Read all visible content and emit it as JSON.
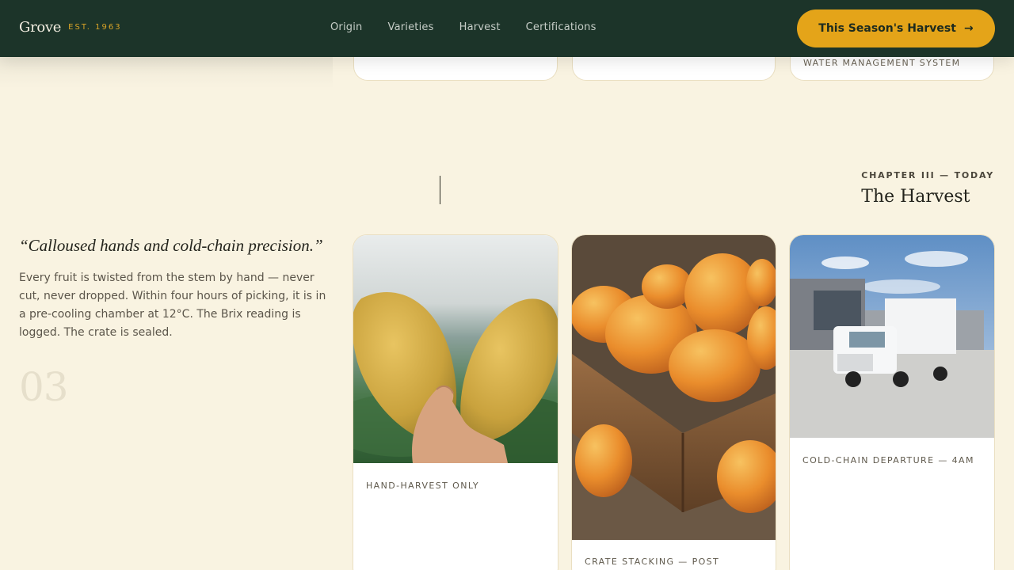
{
  "nav": {
    "brand": "Grove",
    "established": "EST. 1963",
    "links": [
      "Origin",
      "Varieties",
      "Harvest",
      "Certifications"
    ],
    "cta_label": "This Season's Harvest",
    "cta_icon": "arrow-right-icon"
  },
  "previous_section": {
    "card_caption": "WATER MANAGEMENT SYSTEM"
  },
  "chapter": {
    "eyebrow": "CHAPTER III — TODAY",
    "title": "The Harvest",
    "quote": "“Calloused hands and cold-chain precision.”",
    "body": "Every fruit is twisted from the stem by hand — never cut, never dropped. Within four hours of picking, it is in a pre-cooling chamber at 12°C. The Brix reading is logged. The crate is sealed.",
    "number": "03"
  },
  "cards": [
    {
      "caption": "HAND-HARVEST ONLY"
    },
    {
      "caption": "CRATE STACKING — POST"
    },
    {
      "caption": "COLD-CHAIN DEPARTURE — 4AM"
    }
  ],
  "colors": {
    "nav_bg": "#1c3429",
    "accent": "#e4a419",
    "page_bg": "#f9f3e1"
  }
}
